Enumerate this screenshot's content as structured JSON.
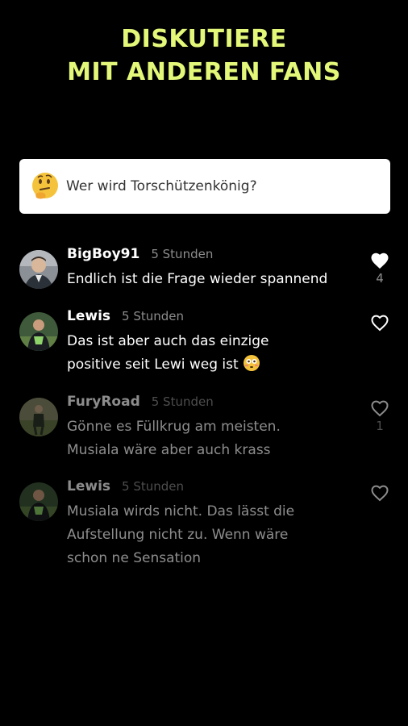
{
  "headline": {
    "line1": "DISKUTIERE",
    "line2": "MIT ANDEREN FANS"
  },
  "question": {
    "emoji": "thinking-face-icon",
    "text": "Wer wird Torschützenkönig?"
  },
  "colors": {
    "accent": "#e3f779",
    "background": "#000000",
    "muted": "#8c8c8c"
  },
  "comments": [
    {
      "user": "BigBoy91",
      "time": "5 Stunden",
      "lines": [
        "Endlich ist die Frage wieder spannend"
      ],
      "liked": true,
      "likes": "4"
    },
    {
      "user": "Lewis",
      "time": "5 Stunden",
      "lines": [
        "Das ist aber auch das einzige",
        "positive seit Lewi weg ist"
      ],
      "emoji": "flushed-face-icon",
      "liked": false,
      "likes": ""
    },
    {
      "user": "FuryRoad",
      "time": "5 Stunden",
      "lines": [
        "Gönne es Füllkrug am meisten.",
        "Musiala wäre aber auch krass"
      ],
      "liked": false,
      "likes": "1"
    },
    {
      "user": "Lewis",
      "time": "5 Stunden",
      "lines": [
        "Musiala wirds nicht. Das lässt die",
        "Aufstellung nicht zu. Wenn wäre",
        "schon ne Sensation"
      ],
      "liked": false,
      "likes": ""
    }
  ]
}
